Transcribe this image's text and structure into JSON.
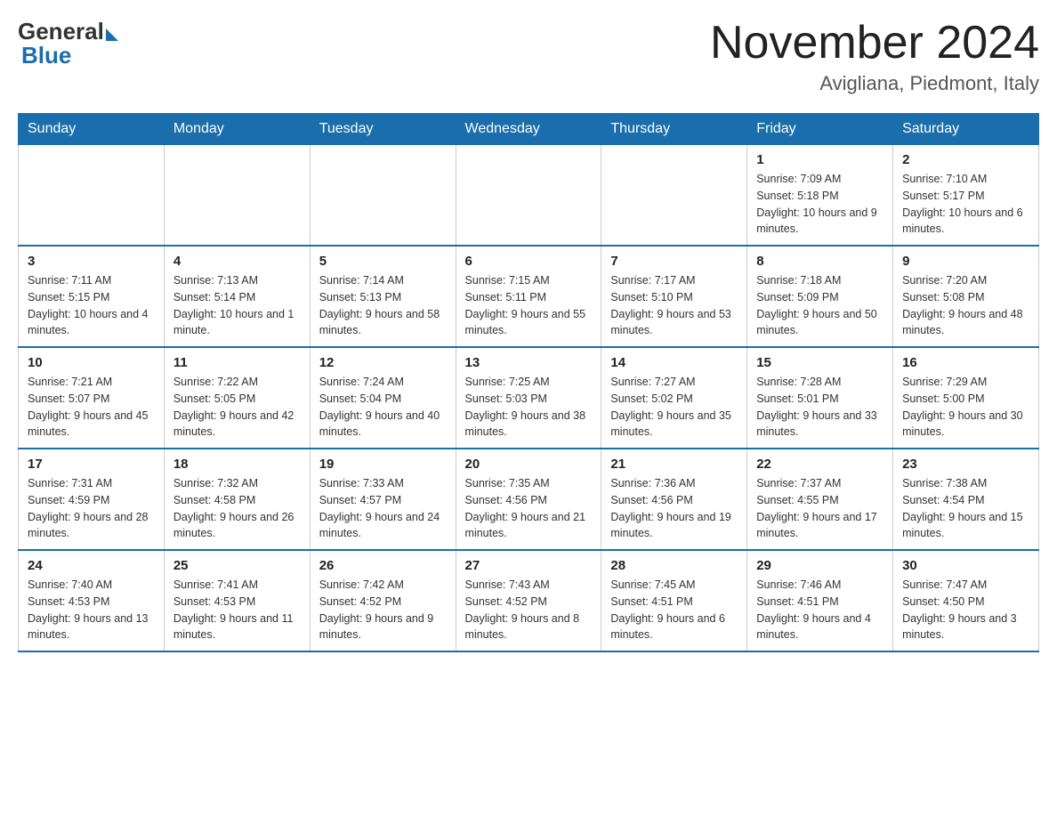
{
  "header": {
    "logo_general": "General",
    "logo_blue": "Blue",
    "title": "November 2024",
    "subtitle": "Avigliana, Piedmont, Italy"
  },
  "days_of_week": [
    "Sunday",
    "Monday",
    "Tuesday",
    "Wednesday",
    "Thursday",
    "Friday",
    "Saturday"
  ],
  "weeks": [
    [
      {
        "day": "",
        "info": ""
      },
      {
        "day": "",
        "info": ""
      },
      {
        "day": "",
        "info": ""
      },
      {
        "day": "",
        "info": ""
      },
      {
        "day": "",
        "info": ""
      },
      {
        "day": "1",
        "info": "Sunrise: 7:09 AM\nSunset: 5:18 PM\nDaylight: 10 hours and 9 minutes."
      },
      {
        "day": "2",
        "info": "Sunrise: 7:10 AM\nSunset: 5:17 PM\nDaylight: 10 hours and 6 minutes."
      }
    ],
    [
      {
        "day": "3",
        "info": "Sunrise: 7:11 AM\nSunset: 5:15 PM\nDaylight: 10 hours and 4 minutes."
      },
      {
        "day": "4",
        "info": "Sunrise: 7:13 AM\nSunset: 5:14 PM\nDaylight: 10 hours and 1 minute."
      },
      {
        "day": "5",
        "info": "Sunrise: 7:14 AM\nSunset: 5:13 PM\nDaylight: 9 hours and 58 minutes."
      },
      {
        "day": "6",
        "info": "Sunrise: 7:15 AM\nSunset: 5:11 PM\nDaylight: 9 hours and 55 minutes."
      },
      {
        "day": "7",
        "info": "Sunrise: 7:17 AM\nSunset: 5:10 PM\nDaylight: 9 hours and 53 minutes."
      },
      {
        "day": "8",
        "info": "Sunrise: 7:18 AM\nSunset: 5:09 PM\nDaylight: 9 hours and 50 minutes."
      },
      {
        "day": "9",
        "info": "Sunrise: 7:20 AM\nSunset: 5:08 PM\nDaylight: 9 hours and 48 minutes."
      }
    ],
    [
      {
        "day": "10",
        "info": "Sunrise: 7:21 AM\nSunset: 5:07 PM\nDaylight: 9 hours and 45 minutes."
      },
      {
        "day": "11",
        "info": "Sunrise: 7:22 AM\nSunset: 5:05 PM\nDaylight: 9 hours and 42 minutes."
      },
      {
        "day": "12",
        "info": "Sunrise: 7:24 AM\nSunset: 5:04 PM\nDaylight: 9 hours and 40 minutes."
      },
      {
        "day": "13",
        "info": "Sunrise: 7:25 AM\nSunset: 5:03 PM\nDaylight: 9 hours and 38 minutes."
      },
      {
        "day": "14",
        "info": "Sunrise: 7:27 AM\nSunset: 5:02 PM\nDaylight: 9 hours and 35 minutes."
      },
      {
        "day": "15",
        "info": "Sunrise: 7:28 AM\nSunset: 5:01 PM\nDaylight: 9 hours and 33 minutes."
      },
      {
        "day": "16",
        "info": "Sunrise: 7:29 AM\nSunset: 5:00 PM\nDaylight: 9 hours and 30 minutes."
      }
    ],
    [
      {
        "day": "17",
        "info": "Sunrise: 7:31 AM\nSunset: 4:59 PM\nDaylight: 9 hours and 28 minutes."
      },
      {
        "day": "18",
        "info": "Sunrise: 7:32 AM\nSunset: 4:58 PM\nDaylight: 9 hours and 26 minutes."
      },
      {
        "day": "19",
        "info": "Sunrise: 7:33 AM\nSunset: 4:57 PM\nDaylight: 9 hours and 24 minutes."
      },
      {
        "day": "20",
        "info": "Sunrise: 7:35 AM\nSunset: 4:56 PM\nDaylight: 9 hours and 21 minutes."
      },
      {
        "day": "21",
        "info": "Sunrise: 7:36 AM\nSunset: 4:56 PM\nDaylight: 9 hours and 19 minutes."
      },
      {
        "day": "22",
        "info": "Sunrise: 7:37 AM\nSunset: 4:55 PM\nDaylight: 9 hours and 17 minutes."
      },
      {
        "day": "23",
        "info": "Sunrise: 7:38 AM\nSunset: 4:54 PM\nDaylight: 9 hours and 15 minutes."
      }
    ],
    [
      {
        "day": "24",
        "info": "Sunrise: 7:40 AM\nSunset: 4:53 PM\nDaylight: 9 hours and 13 minutes."
      },
      {
        "day": "25",
        "info": "Sunrise: 7:41 AM\nSunset: 4:53 PM\nDaylight: 9 hours and 11 minutes."
      },
      {
        "day": "26",
        "info": "Sunrise: 7:42 AM\nSunset: 4:52 PM\nDaylight: 9 hours and 9 minutes."
      },
      {
        "day": "27",
        "info": "Sunrise: 7:43 AM\nSunset: 4:52 PM\nDaylight: 9 hours and 8 minutes."
      },
      {
        "day": "28",
        "info": "Sunrise: 7:45 AM\nSunset: 4:51 PM\nDaylight: 9 hours and 6 minutes."
      },
      {
        "day": "29",
        "info": "Sunrise: 7:46 AM\nSunset: 4:51 PM\nDaylight: 9 hours and 4 minutes."
      },
      {
        "day": "30",
        "info": "Sunrise: 7:47 AM\nSunset: 4:50 PM\nDaylight: 9 hours and 3 minutes."
      }
    ]
  ]
}
